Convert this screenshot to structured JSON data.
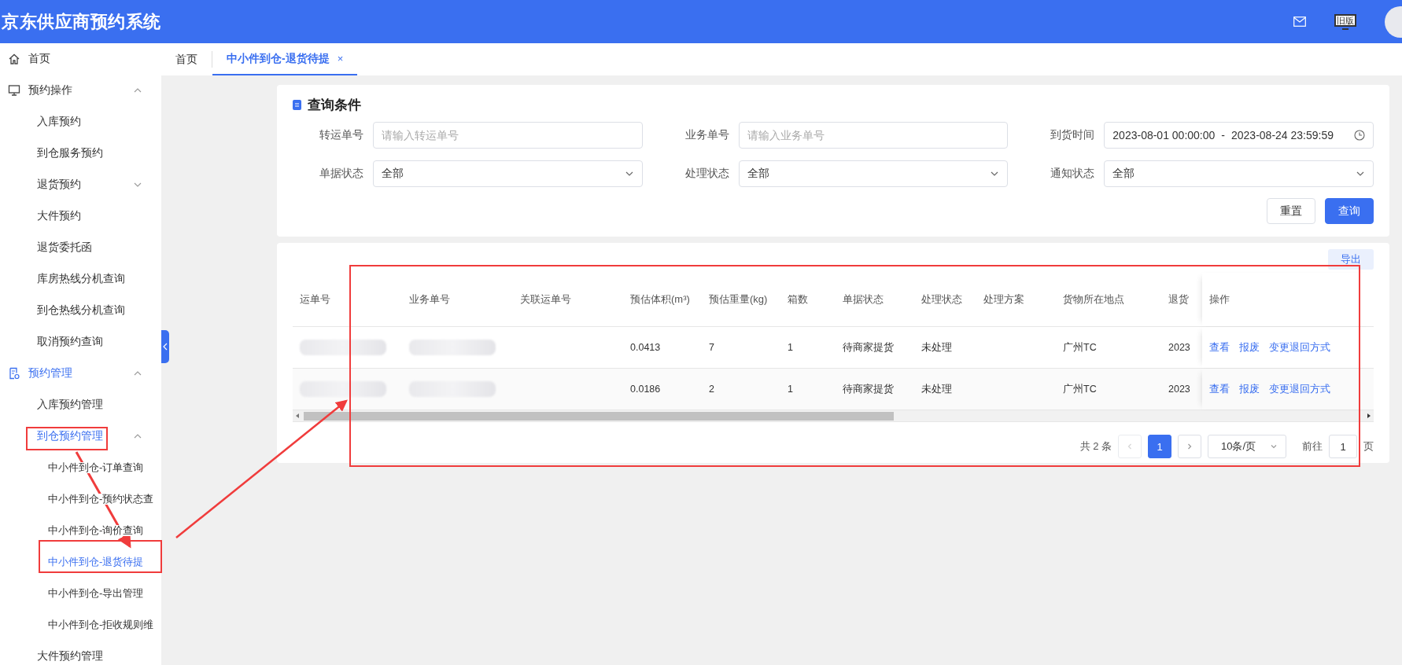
{
  "header": {
    "title": "京东供应商预约系统",
    "legacy_label": "旧版"
  },
  "sidebar": {
    "items": [
      {
        "label": "首页",
        "selected": false
      },
      {
        "label": "预约操作",
        "expanded": true,
        "selected": false,
        "children": [
          {
            "label": "入库预约",
            "selected": false
          },
          {
            "label": "到仓服务预约",
            "selected": false
          },
          {
            "label": "退货预约",
            "expanded": false,
            "selected": false
          },
          {
            "label": "大件预约",
            "selected": false
          },
          {
            "label": "退货委托函",
            "selected": false
          },
          {
            "label": "库房热线分机查询",
            "selected": false
          },
          {
            "label": "到仓热线分机查询",
            "selected": false
          },
          {
            "label": "取消预约查询",
            "selected": false
          }
        ]
      },
      {
        "label": "预约管理",
        "expanded": true,
        "selected": true,
        "children": [
          {
            "label": "入库预约管理",
            "selected": false
          },
          {
            "label": "到仓预约管理",
            "expanded": true,
            "selected": true,
            "children": [
              {
                "label": "中小件到仓-订单查询",
                "selected": false
              },
              {
                "label": "中小件到仓-预约状态查",
                "selected": false
              },
              {
                "label": "中小件到仓-询价查询",
                "selected": false
              },
              {
                "label": "中小件到仓-退货待提",
                "selected": true
              },
              {
                "label": "中小件到仓-导出管理",
                "selected": false
              },
              {
                "label": "中小件到仓-拒收规则维",
                "selected": false
              }
            ]
          },
          {
            "label": "大件预约管理",
            "selected": false
          }
        ]
      }
    ]
  },
  "tabs": [
    {
      "label": "首页",
      "selected": false
    },
    {
      "label": "中小件到仓-退货待提",
      "selected": true,
      "close": "×"
    }
  ],
  "query": {
    "title": "查询条件",
    "fields": [
      {
        "label": "转运单号",
        "kind": "input",
        "placeholder": "请输入转运单号"
      },
      {
        "label": "业务单号",
        "kind": "input",
        "placeholder": "请输入业务单号"
      },
      {
        "label": "到货时间",
        "kind": "daterange",
        "start": "2023-08-01 00:00:00",
        "separator": "-",
        "end": "2023-08-24 23:59:59"
      },
      {
        "label": "单据状态",
        "kind": "select",
        "value": "全部"
      },
      {
        "label": "处理状态",
        "kind": "select",
        "value": "全部"
      },
      {
        "label": "通知状态",
        "kind": "select",
        "value": "全部"
      }
    ],
    "buttons": [
      {
        "label": "重置",
        "kind": "default"
      },
      {
        "label": "查询",
        "kind": "primary"
      }
    ]
  },
  "table": {
    "export_button": "导出",
    "columns": [
      "运单号",
      "业务单号",
      "关联运单号",
      "预估体积(m³)",
      "预估重量(kg)",
      "箱数",
      "单据状态",
      "处理状态",
      "处理方案",
      "货物所在地点",
      "退货",
      "操作"
    ],
    "rows": [
      {
        "cells": [
          {
            "kind": "redacted"
          },
          {
            "kind": "redacted"
          },
          {
            "kind": "empty"
          },
          {
            "kind": "text",
            "text": "0.0413"
          },
          {
            "kind": "text",
            "text": "7"
          },
          {
            "kind": "text",
            "text": "1"
          },
          {
            "kind": "text",
            "text": "待商家提货"
          },
          {
            "kind": "text",
            "text": "未处理"
          },
          {
            "kind": "empty"
          },
          {
            "kind": "text",
            "text": "广州TC"
          },
          {
            "kind": "text",
            "text": "2023"
          }
        ],
        "actions": [
          "查看",
          "报废",
          "变更退回方式"
        ]
      },
      {
        "cells": [
          {
            "kind": "redacted"
          },
          {
            "kind": "redacted"
          },
          {
            "kind": "empty"
          },
          {
            "kind": "text",
            "text": "0.0186"
          },
          {
            "kind": "text",
            "text": "2"
          },
          {
            "kind": "text",
            "text": "1"
          },
          {
            "kind": "text",
            "text": "待商家提货"
          },
          {
            "kind": "text",
            "text": "未处理"
          },
          {
            "kind": "empty"
          },
          {
            "kind": "text",
            "text": "广州TC"
          },
          {
            "kind": "text",
            "text": "2023"
          }
        ],
        "actions": [
          "查看",
          "报废",
          "变更退回方式"
        ]
      }
    ]
  },
  "pagination": {
    "total": "共 2 条",
    "prev_disabled": true,
    "pages": [
      {
        "label": "1",
        "selected": true
      }
    ],
    "page_size": "10条/页",
    "goto_label": "前往",
    "goto_value": "1",
    "page_unit": "页"
  }
}
